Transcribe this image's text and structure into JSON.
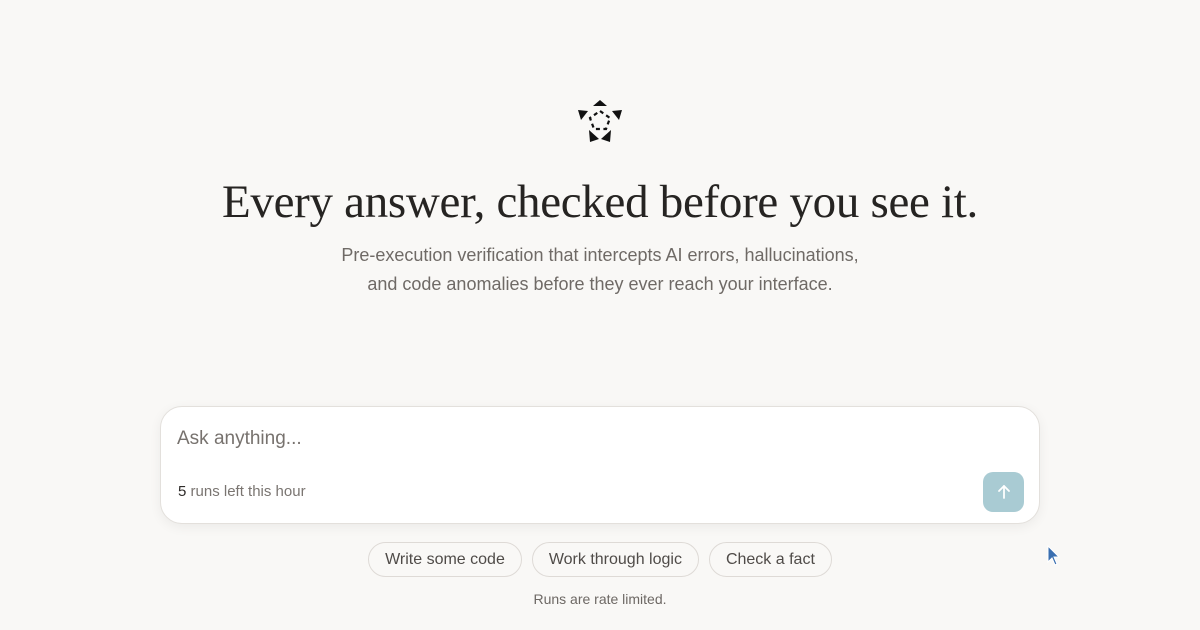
{
  "hero": {
    "logo_icon": "pentagon-arrows-logo-icon",
    "headline": "Every answer, checked before you see it.",
    "subtitle": "Pre-execution verification that intercepts AI errors, hallucinations, and code anomalies before they ever reach your interface."
  },
  "prompt": {
    "placeholder": "Ask anything...",
    "value": "",
    "runs_count": "5",
    "runs_label": "runs left this hour",
    "submit_icon": "arrow-up-icon",
    "submit_color": "#a9cbd3"
  },
  "suggestions": [
    {
      "label": "Write some code"
    },
    {
      "label": "Work through logic"
    },
    {
      "label": "Check a fact"
    }
  ],
  "footer": {
    "note": "Runs are rate limited."
  },
  "colors": {
    "background": "#f9f8f6",
    "headline": "#262422",
    "muted": "#6f6a66",
    "accent": "#a9cbd3"
  }
}
